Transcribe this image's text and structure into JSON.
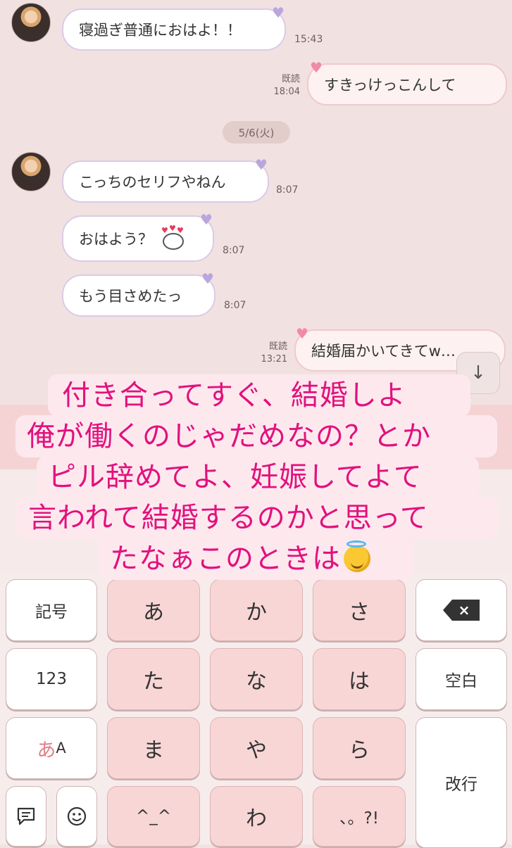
{
  "chat": {
    "messages": [
      {
        "text": "寝過ぎ普通におはよ！！",
        "time": "15:43"
      },
      {
        "read": "既読",
        "text": "すきっけっこんして",
        "time": "18:04"
      },
      {
        "text": "こっちのセリフやねん",
        "time": "8:07"
      },
      {
        "text": "おはよう？",
        "time": "8:07"
      },
      {
        "text": "もう目さめたっ",
        "time": "8:07"
      },
      {
        "read": "既読",
        "text": "結婚届かいてきてw…",
        "time": "13:21"
      }
    ],
    "date_label": "5/6(火)",
    "scroll_down_icon": "↓"
  },
  "overlay": {
    "lines": [
      "付き合ってすぐ、結婚しよ",
      "俺が働くのじゃだめなの？とか",
      "ピル辞めてよ、妊娠してよて",
      "言われて結婚するのかと思って",
      "たなぁこのときは"
    ]
  },
  "keyboard": {
    "symbols": "記号",
    "numbers": "123",
    "kana_a": "あ",
    "kana_A": "A",
    "row1": [
      "あ",
      "か",
      "さ"
    ],
    "row2": [
      "た",
      "な",
      "は"
    ],
    "row3": [
      "ま",
      "や",
      "ら"
    ],
    "row4": [
      "^_^",
      "わ",
      "、。?!"
    ],
    "space": "空白",
    "enter": "改行",
    "backspace_icon": "×"
  }
}
